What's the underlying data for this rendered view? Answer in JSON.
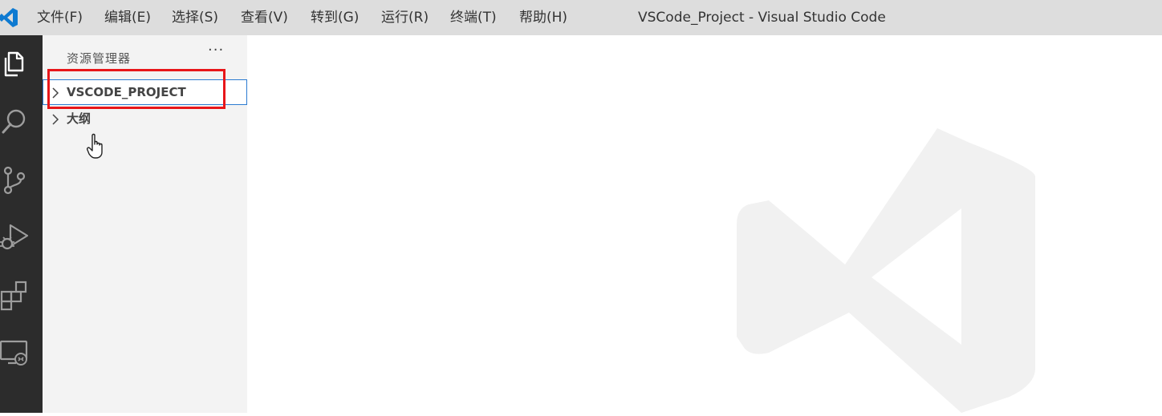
{
  "menu": [
    {
      "label": "文件(F)",
      "name": "menu-file"
    },
    {
      "label": "编辑(E)",
      "name": "menu-edit"
    },
    {
      "label": "选择(S)",
      "name": "menu-selection"
    },
    {
      "label": "查看(V)",
      "name": "menu-view"
    },
    {
      "label": "转到(G)",
      "name": "menu-go"
    },
    {
      "label": "运行(R)",
      "name": "menu-run"
    },
    {
      "label": "终端(T)",
      "name": "menu-terminal"
    },
    {
      "label": "帮助(H)",
      "name": "menu-help"
    }
  ],
  "window": {
    "title": "VSCode_Project - Visual Studio Code"
  },
  "activity_bar": {
    "icons": [
      "explorer-icon",
      "search-icon",
      "source-control-icon",
      "run-debug-icon",
      "extensions-icon",
      "remote-explorer-icon"
    ]
  },
  "sidebar": {
    "title": "资源管理器",
    "more_actions": "···",
    "sections": [
      {
        "label": "VSCODE_PROJECT",
        "selected": true
      },
      {
        "label": "大纲",
        "selected": false
      }
    ]
  },
  "colors": {
    "titlebar": "#dddddd",
    "activity_bar": "#2c2c2c",
    "sidebar": "#f3f3f3",
    "focus_border": "#2b7bd1",
    "annotation_box": "#e8161a",
    "vscode_blue": "#0e7ad1"
  }
}
